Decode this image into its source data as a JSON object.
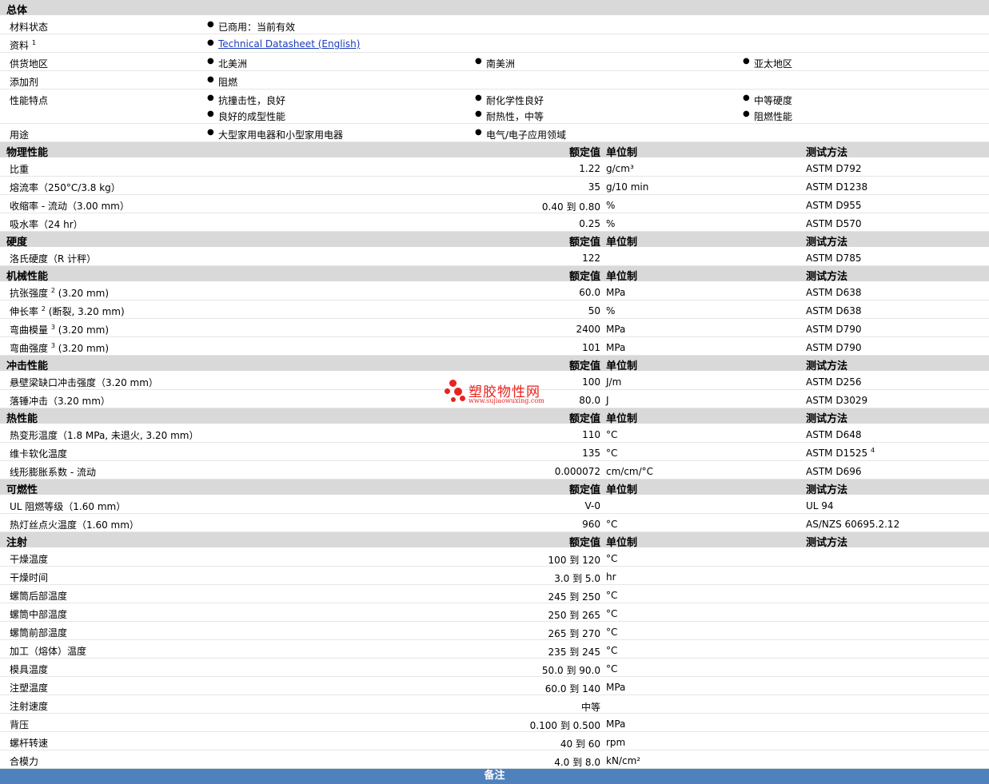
{
  "general": {
    "title": "总体",
    "status": {
      "label": "材料状态",
      "values": [
        "已商用：当前有效"
      ]
    },
    "docs": {
      "label": "资料",
      "sup": "1",
      "link": "Technical Datasheet (English)"
    },
    "availability": {
      "label": "供货地区",
      "values": [
        "北美洲",
        "南美洲",
        "亚太地区"
      ]
    },
    "additive": {
      "label": "添加剂",
      "values": [
        "阻燃"
      ]
    },
    "features": {
      "label": "性能特点",
      "row1": [
        "抗撞击性，良好",
        "耐化学性良好",
        "中等硬度"
      ],
      "row2": [
        "良好的成型性能",
        "耐热性，中等",
        "阻燃性能"
      ]
    },
    "uses": {
      "label": "用途",
      "values": [
        "大型家用电器和小型家用电器",
        "电气/电子应用领域"
      ]
    }
  },
  "headers": {
    "nominal": "额定值",
    "unit": "单位制",
    "test": "测试方法"
  },
  "sections": [
    {
      "title": "物理性能",
      "rows": [
        {
          "label": "比重",
          "value": "1.22",
          "unit": "g/cm³",
          "test": "ASTM D792"
        },
        {
          "label": "熔流率（250°C/3.8 kg）",
          "value": "35",
          "unit": "g/10 min",
          "test": "ASTM D1238"
        },
        {
          "label": "收缩率 - 流动（3.00 mm）",
          "value": "0.40 到  0.80",
          "unit": "%",
          "test": "ASTM D955"
        },
        {
          "label": "吸水率（24 hr）",
          "value": "0.25",
          "unit": "%",
          "test": "ASTM D570"
        }
      ]
    },
    {
      "title": "硬度",
      "rows": [
        {
          "label": "洛氏硬度（R 计秤）",
          "value": "122",
          "unit": "",
          "test": "ASTM D785"
        }
      ]
    },
    {
      "title": "机械性能",
      "rows": [
        {
          "label": "抗张强度",
          "sup": "2",
          "label2": "(3.20 mm)",
          "value": "60.0",
          "unit": "MPa",
          "test": "ASTM D638"
        },
        {
          "label": "伸长率",
          "sup": "2",
          "label2": "(断裂, 3.20 mm)",
          "value": "50",
          "unit": "%",
          "test": "ASTM D638"
        },
        {
          "label": "弯曲模量",
          "sup": "3",
          "label2": "(3.20 mm)",
          "value": "2400",
          "unit": "MPa",
          "test": "ASTM D790"
        },
        {
          "label": "弯曲强度",
          "sup": "3",
          "label2": "(3.20 mm)",
          "value": "101",
          "unit": "MPa",
          "test": "ASTM D790"
        }
      ]
    },
    {
      "title": "冲击性能",
      "rows": [
        {
          "label": "悬壁梁缺口冲击强度（3.20 mm）",
          "value": "100",
          "unit": "J/m",
          "test": "ASTM D256"
        },
        {
          "label": "落锤冲击（3.20 mm）",
          "value": "80.0",
          "unit": "J",
          "test": "ASTM D3029"
        }
      ]
    },
    {
      "title": "热性能",
      "rows": [
        {
          "label": "热变形温度（1.8 MPa, 未退火, 3.20 mm）",
          "value": "110",
          "unit": "°C",
          "test": "ASTM D648"
        },
        {
          "label": "维卡软化温度",
          "value": "135",
          "unit": "°C",
          "test": "ASTM D1525",
          "test_sup": "4"
        },
        {
          "label": "线形膨胀系数 - 流动",
          "value": "0.000072",
          "unit": "cm/cm/°C",
          "test": "ASTM D696"
        }
      ]
    },
    {
      "title": "可燃性",
      "rows": [
        {
          "label": "UL 阻燃等级（1.60 mm）",
          "value": "V-0",
          "unit": "",
          "test": "UL 94"
        },
        {
          "label": "热灯丝点火温度（1.60 mm）",
          "value": "960",
          "unit": "°C",
          "test": "AS/NZS 60695.2.12"
        }
      ]
    },
    {
      "title": "注射",
      "rows": [
        {
          "label": "干燥温度",
          "value": "100 到  120",
          "unit": "°C",
          "test": ""
        },
        {
          "label": "干燥时间",
          "value": "3.0 到  5.0",
          "unit": "hr",
          "test": ""
        },
        {
          "label": "螺筒后部温度",
          "value": "245 到  250",
          "unit": "°C",
          "test": ""
        },
        {
          "label": "螺筒中部温度",
          "value": "250 到  265",
          "unit": "°C",
          "test": ""
        },
        {
          "label": "螺筒前部温度",
          "value": "265 到  270",
          "unit": "°C",
          "test": ""
        },
        {
          "label": "加工（熔体）温度",
          "value": "235 到  245",
          "unit": "°C",
          "test": ""
        },
        {
          "label": "模具温度",
          "value": "50.0 到  90.0",
          "unit": "°C",
          "test": ""
        },
        {
          "label": "注塑温度",
          "value": "60.0 到  140",
          "unit": "MPa",
          "test": ""
        },
        {
          "label": "注射速度",
          "value": "中等",
          "unit": "",
          "test": ""
        },
        {
          "label": "背压",
          "value": "0.100 到  0.500",
          "unit": "MPa",
          "test": ""
        },
        {
          "label": "螺杆转速",
          "value": "40 到  60",
          "unit": "rpm",
          "test": ""
        },
        {
          "label": "合模力",
          "value": "4.0 到  8.0",
          "unit": "kN/cm²",
          "test": ""
        }
      ]
    }
  ],
  "footer": "备注",
  "watermark": {
    "title": "塑胶物性网",
    "url": "www.sujiaowuxing.com"
  }
}
